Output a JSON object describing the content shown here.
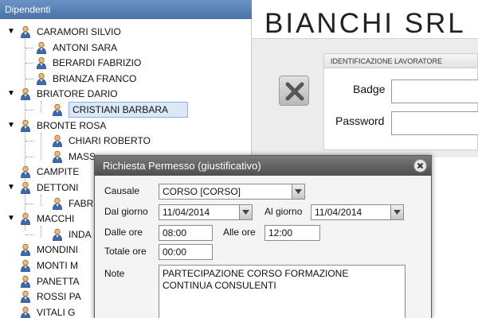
{
  "tree": {
    "title": "Dipendenti",
    "rows": [
      {
        "label": "CARAMORI SILVIO",
        "expanded": true
      },
      {
        "label": "ANTONI SARA"
      },
      {
        "label": "BERARDI FABRIZIO"
      },
      {
        "label": "BRIANZA FRANCO"
      },
      {
        "label": "BRIATORE DARIO",
        "expanded": true
      },
      {
        "label": "CRISTIANI BARBARA",
        "selected": true
      },
      {
        "label": "BRONTE ROSA",
        "expanded": true
      },
      {
        "label": "CHIARI ROBERTO"
      },
      {
        "label": "MASS"
      },
      {
        "label": "CAMPITE"
      },
      {
        "label": "DETTONI",
        "expanded": true
      },
      {
        "label": "FABR"
      },
      {
        "label": "MACCHI",
        "expanded": true
      },
      {
        "label": "INDA"
      },
      {
        "label": "MONDINI"
      },
      {
        "label": "MONTI M"
      },
      {
        "label": "PANETTA"
      },
      {
        "label": "ROSSI PA"
      },
      {
        "label": "VITALI G"
      }
    ]
  },
  "company": {
    "name": "BIANCHI SRL"
  },
  "login": {
    "section_title": "IDENTIFICAZIONE LAVORATORE",
    "badge_label": "Badge",
    "password_label": "Password"
  },
  "dialog": {
    "title": "Richiesta Permesso (giustificativo)",
    "causale_label": "Causale",
    "causale_value": "CORSO [CORSO]",
    "dal_giorno_label": "Dal giorno",
    "dal_giorno_value": "11/04/2014",
    "al_giorno_label": "Al giorno",
    "al_giorno_value": "11/04/2014",
    "dalle_ore_label": "Dalle ore",
    "dalle_ore_value": "08:00",
    "alle_ore_label": "Alle ore",
    "alle_ore_value": "12:00",
    "totale_ore_label": "Totale ore",
    "totale_ore_value": "00:00",
    "note_label": "Note",
    "note_value": "PARTECIPAZIONE CORSO FORMAZIONE\nCONTINUA CONSULENTI"
  },
  "icons": {
    "person": "person-icon",
    "close": "close-icon",
    "dropdown": "chevron-down-icon",
    "cancel": "x-mark-icon"
  },
  "colors": {
    "header_blue": "#5b82b8",
    "dialog_title": "#5e5e5e",
    "selection": "#dbe8f8"
  }
}
